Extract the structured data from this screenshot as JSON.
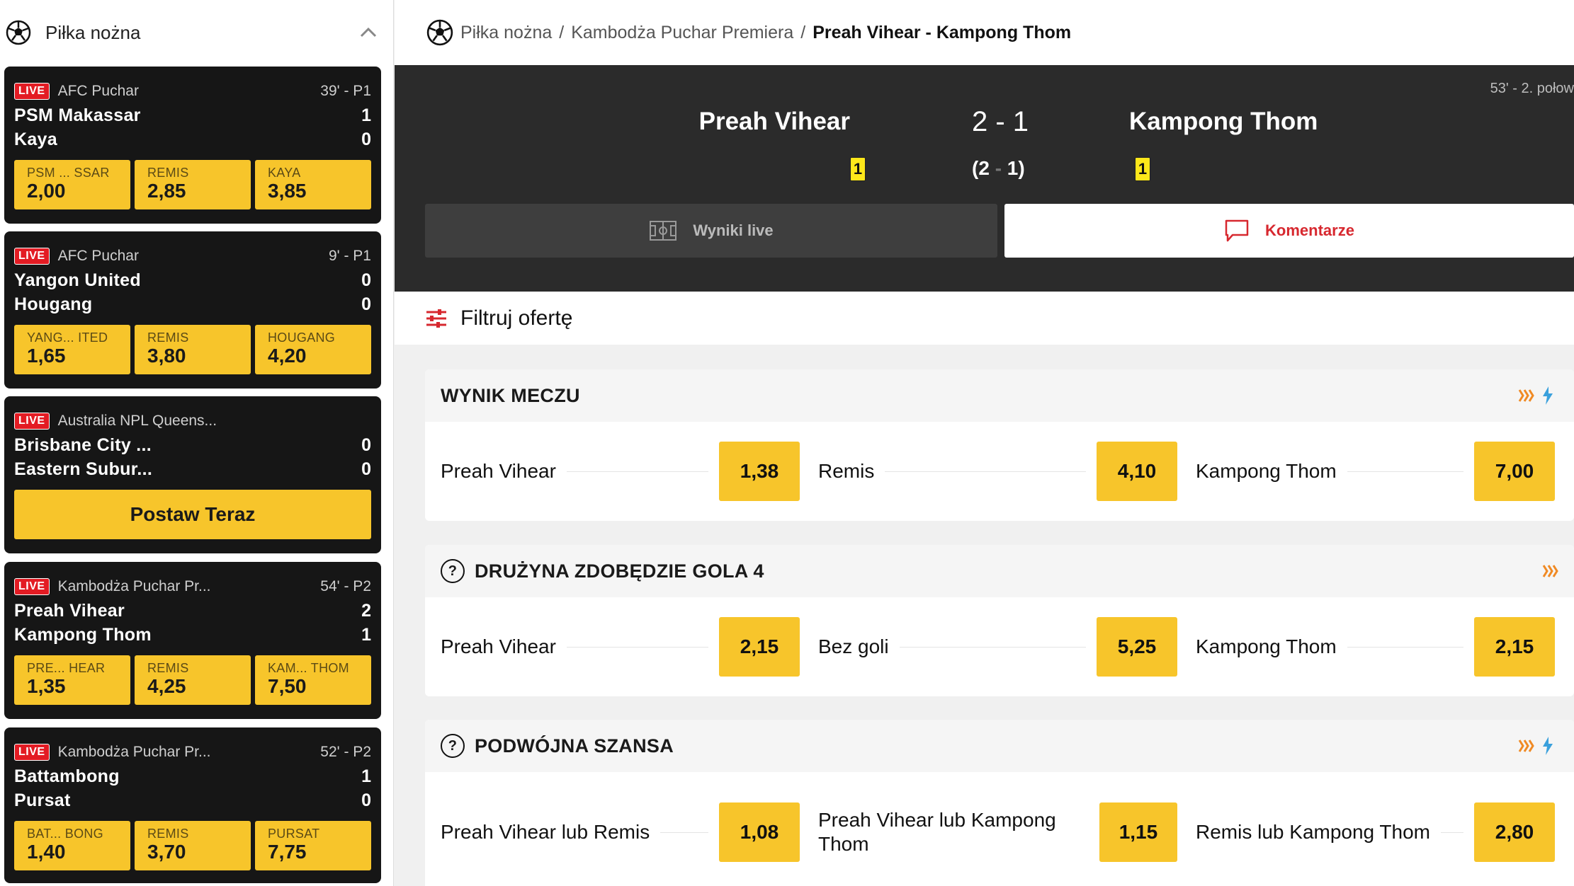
{
  "sidebar": {
    "title": "Piłka nożna",
    "cards": [
      {
        "live": "LIVE",
        "league": "AFC Puchar",
        "time": "39' - P1",
        "home": "PSM Makassar",
        "away": "Kaya",
        "home_score": "1",
        "away_score": "0",
        "odds": [
          {
            "label": "PSM ... SSAR",
            "value": "2,00"
          },
          {
            "label": "REMIS",
            "value": "2,85"
          },
          {
            "label": "KAYA",
            "value": "3,85"
          }
        ]
      },
      {
        "live": "LIVE",
        "league": "AFC Puchar",
        "time": "9' - P1",
        "home": "Yangon United",
        "away": "Hougang",
        "home_score": "0",
        "away_score": "0",
        "odds": [
          {
            "label": "YANG... ITED",
            "value": "1,65"
          },
          {
            "label": "REMIS",
            "value": "3,80"
          },
          {
            "label": "HOUGANG",
            "value": "4,20"
          }
        ]
      },
      {
        "live": "LIVE",
        "league": "Australia NPL Queens...",
        "time": "",
        "home": "Brisbane City ...",
        "away": "Eastern Subur...",
        "home_score": "0",
        "away_score": "0",
        "cta": "Postaw Teraz"
      },
      {
        "live": "LIVE",
        "league": "Kambodża Puchar Pr...",
        "time": "54' - P2",
        "home": "Preah Vihear",
        "away": "Kampong Thom",
        "home_score": "2",
        "away_score": "1",
        "odds": [
          {
            "label": "PRE... HEAR",
            "value": "1,35"
          },
          {
            "label": "REMIS",
            "value": "4,25"
          },
          {
            "label": "KAM... THOM",
            "value": "7,50"
          }
        ]
      },
      {
        "live": "LIVE",
        "league": "Kambodża Puchar Pr...",
        "time": "52' - P2",
        "home": "Battambong",
        "away": "Pursat",
        "home_score": "1",
        "away_score": "0",
        "odds": [
          {
            "label": "BAT... BONG",
            "value": "1,40"
          },
          {
            "label": "REMIS",
            "value": "3,70"
          },
          {
            "label": "PURSAT",
            "value": "7,75"
          }
        ]
      }
    ]
  },
  "breadcrumb": {
    "sport": "Piłka nożna",
    "sep": "/",
    "competition": "Kambodża Puchar Premiera",
    "match": "Preah Vihear - Kampong Thom"
  },
  "scoreboard": {
    "time": "53' - 2. połow",
    "home": "Preah Vihear",
    "away": "Kampong Thom",
    "score": "2 - 1",
    "half_open": "(2",
    "half_dash": "-",
    "half_close": "1)",
    "home_cards": "1",
    "away_cards": "1",
    "tab_live": "Wyniki live",
    "tab_comments": "Komentarze"
  },
  "filter": {
    "label": "Filtruj ofertę"
  },
  "markets": [
    {
      "title": "WYNIK MECZU",
      "selections": [
        {
          "name": "Preah Vihear",
          "price": "1,38"
        },
        {
          "name": "Remis",
          "price": "4,10"
        },
        {
          "name": "Kampong Thom",
          "price": "7,00"
        }
      ]
    },
    {
      "title": "DRUŻYNA ZDOBĘDZIE GOLA 4",
      "selections": [
        {
          "name": "Preah Vihear",
          "price": "2,15"
        },
        {
          "name": "Bez goli",
          "price": "5,25"
        },
        {
          "name": "Kampong Thom",
          "price": "2,15"
        }
      ]
    },
    {
      "title": "PODWÓJNA SZANSA",
      "selections": [
        {
          "name": "Preah Vihear lub Remis",
          "price": "1,08"
        },
        {
          "name": "Preah Vihear lub Kampong Thom",
          "price": "1,15"
        },
        {
          "name": "Remis lub Kampong Thom",
          "price": "2,80"
        }
      ]
    }
  ],
  "colors": {
    "accent_yellow": "#f7c52b",
    "live_red": "#e31b23",
    "card_bg": "#161616",
    "scoreboard_bg": "#2b2b2b",
    "comment_red": "#d7282f",
    "live_icon_orange": "#f08a24",
    "stats_icon_blue": "#3aa0dc"
  },
  "icons": {
    "sport": "soccer-ball-icon",
    "collapse": "chevron-up-icon",
    "live_results": "pitch-icon",
    "comments": "chat-bubble-icon",
    "filter": "sliders-icon",
    "market_live": "live-stream-icon",
    "market_stats": "stats-arrows-icon",
    "info": "question-icon"
  }
}
